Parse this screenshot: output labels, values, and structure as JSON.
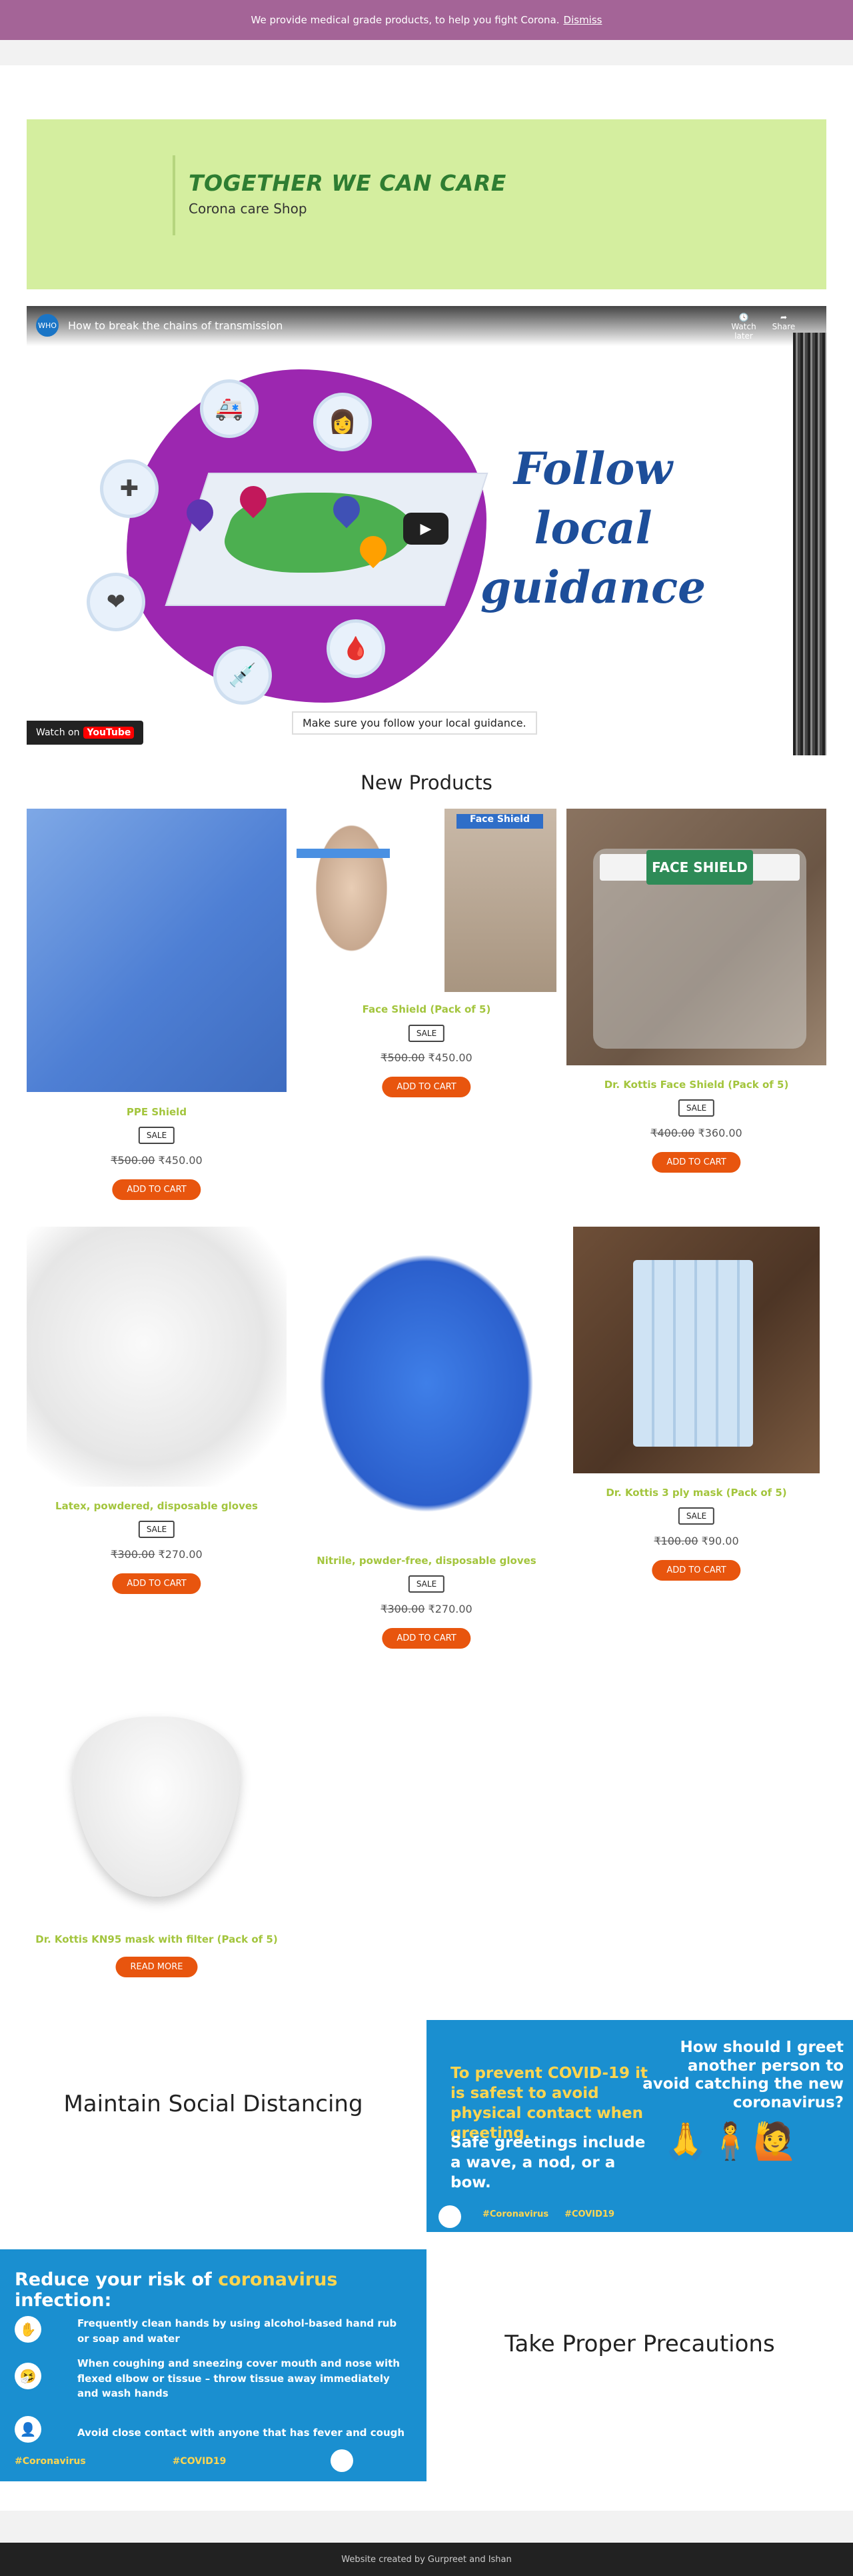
{
  "notice": {
    "text": "We provide medical grade products, to help you fight Corona.",
    "dismiss": "Dismiss"
  },
  "hero": {
    "title": "TOGETHER WE CAN CARE",
    "subtitle": "Corona care Shop"
  },
  "video": {
    "title": "How to break the chains of transmission",
    "channel_badge": "WHO",
    "watch_later": "Watch later",
    "share": "Share",
    "headline": "Follow local guidance",
    "caption": "Make sure you follow your local guidance.",
    "watch_on": "Watch on",
    "youtube": "YouTube"
  },
  "section_title": "New Products",
  "products": [
    {
      "name": "PPE Shield",
      "badge": "SALE",
      "old_price": "₹500.00",
      "price": "₹450.00",
      "button": "ADD TO CART"
    },
    {
      "name": "Face Shield (Pack of 5)",
      "badge": "SALE",
      "old_price": "₹500.00",
      "price": "₹450.00",
      "button": "ADD TO CART",
      "image_text": "Face Shield"
    },
    {
      "name": "Dr. Kottis Face Shield (Pack of 5)",
      "badge": "SALE",
      "old_price": "₹400.00",
      "price": "₹360.00",
      "button": "ADD TO CART",
      "image_text": "FACE SHIELD"
    },
    {
      "name": "Latex, powdered, disposable gloves",
      "badge": "SALE",
      "old_price": "₹300.00",
      "price": "₹270.00",
      "button": "ADD TO CART"
    },
    {
      "name": "Nitrile, powder-free, disposable gloves",
      "badge": "SALE",
      "old_price": "₹300.00",
      "price": "₹270.00",
      "button": "ADD TO CART"
    },
    {
      "name": "Dr. Kottis 3 ply mask (Pack of 5)",
      "badge": "SALE",
      "old_price": "₹100.00",
      "price": "₹90.00",
      "button": "ADD TO CART"
    },
    {
      "name": "Dr. Kottis KN95 mask with filter (Pack of 5)",
      "button": "READ MORE"
    }
  ],
  "social": {
    "heading": "Maintain Social Distancing"
  },
  "greet_poster": {
    "question": "How should I greet another person to avoid catching the new coronavirus?",
    "answer1": "To prevent COVID-19 it is safest to avoid physical contact when greeting.",
    "answer2": "Safe greetings include a wave, a nod, or a bow.",
    "tag1": "#Coronavirus",
    "tag2": "#COVID19"
  },
  "risk_poster": {
    "title_prefix": "Reduce your risk of",
    "title_highlight": "coronavirus",
    "title_suffix": "infection:",
    "tips": [
      "Frequently clean hands by using alcohol-based hand rub or soap and water",
      "When coughing and sneezing cover mouth and nose with flexed elbow or tissue – throw tissue away immediately and wash hands",
      "Avoid close contact with anyone that has fever and cough"
    ],
    "tag1": "#Coronavirus",
    "tag2": "#COVID19"
  },
  "precaution": {
    "heading": "Take Proper Precautions"
  },
  "footer": {
    "text": "Website created by Gurpreet and Ishan"
  }
}
